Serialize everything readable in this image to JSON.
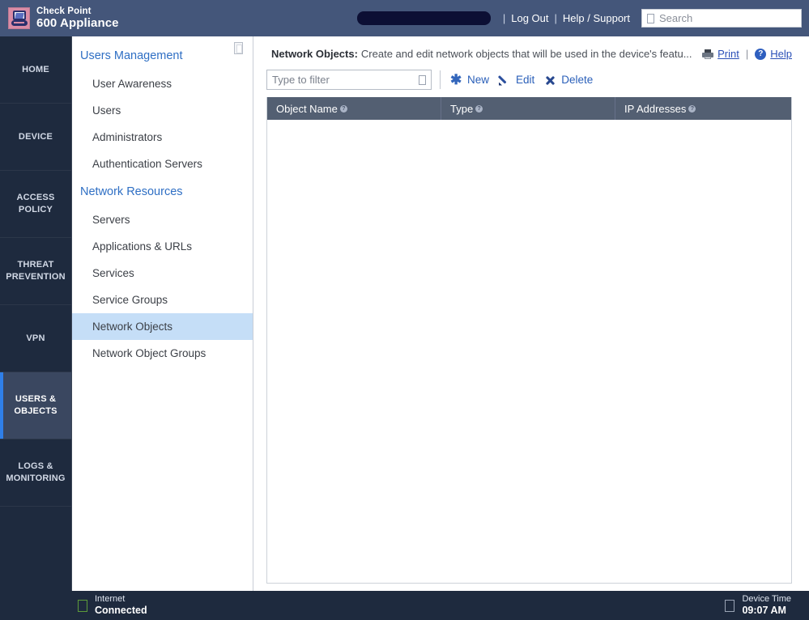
{
  "header": {
    "brand_line1": "Check Point",
    "brand_line2": "600 Appliance",
    "logo_icon": "checkpoint-logo-icon",
    "redacted_field": "",
    "separator1": "|",
    "logout_label": "Log Out",
    "separator2": "|",
    "help_support_label": "Help / Support",
    "search_placeholder": "Search",
    "search_value": "",
    "search_icon": "search-icon",
    "bg_color": "#44567a"
  },
  "mainnav": {
    "items": [
      {
        "label": "HOME",
        "selected": false
      },
      {
        "label": "DEVICE",
        "selected": false
      },
      {
        "label": "ACCESS POLICY",
        "selected": false
      },
      {
        "label": "THREAT PREVENTION",
        "selected": false
      },
      {
        "label": "VPN",
        "selected": false
      },
      {
        "label": "USERS & OBJECTS",
        "selected": true
      },
      {
        "label": "LOGS & MONITORING",
        "selected": false
      }
    ],
    "bg_color": "#1e2a3e",
    "selected_bg_color": "#3a4760",
    "accent_color": "#2f7fe8"
  },
  "subnav": {
    "collapse_icon": "collapse-panel-icon",
    "groups": [
      {
        "title": "Users Management",
        "items": [
          {
            "label": "User Awareness",
            "active": false
          },
          {
            "label": "Users",
            "active": false
          },
          {
            "label": "Administrators",
            "active": false
          },
          {
            "label": "Authentication Servers",
            "active": false
          }
        ]
      },
      {
        "title": "Network Resources",
        "items": [
          {
            "label": "Servers",
            "active": false
          },
          {
            "label": "Applications & URLs",
            "active": false
          },
          {
            "label": "Services",
            "active": false
          },
          {
            "label": "Service Groups",
            "active": false
          },
          {
            "label": "Network Objects",
            "active": true
          },
          {
            "label": "Network Object Groups",
            "active": false
          }
        ]
      }
    ],
    "group_title_color": "#2f6fc4",
    "active_bg_color": "#c5def7"
  },
  "content": {
    "page_title": "Network Objects:",
    "page_description": "Create and edit network objects that will be used in the device's featu...",
    "print_label": "Print",
    "print_icon": "printer-icon",
    "pipe": "|",
    "help_label": "Help",
    "help_icon": "help-circle-icon",
    "link_color": "#2a4fb7"
  },
  "toolbar": {
    "filter_placeholder": "Type to filter",
    "filter_value": "",
    "filter_icon": "filter-icon",
    "new_label": "New",
    "new_icon": "new-star-icon",
    "edit_label": "Edit",
    "edit_icon": "pencil-edit-icon",
    "delete_label": "Delete",
    "delete_icon": "delete-x-icon",
    "action_color": "#2a5fb9"
  },
  "table": {
    "columns": [
      {
        "label": "Object Name",
        "info_icon": "info-icon",
        "info_glyph": "?"
      },
      {
        "label": "Type",
        "info_icon": "info-icon",
        "info_glyph": "?"
      },
      {
        "label": "IP Addresses",
        "info_icon": "info-icon",
        "info_glyph": "?"
      }
    ],
    "rows": [],
    "header_bg_color": "#535f72"
  },
  "statusbar": {
    "internet_label": "Internet",
    "internet_status": "Connected",
    "internet_icon": "status-led-icon",
    "device_time_label": "Device Time",
    "device_time_value": "09:07 AM",
    "device_time_icon": "clock-icon",
    "bg_color": "#1e2a3e",
    "led_color": "#5d9b3a"
  }
}
